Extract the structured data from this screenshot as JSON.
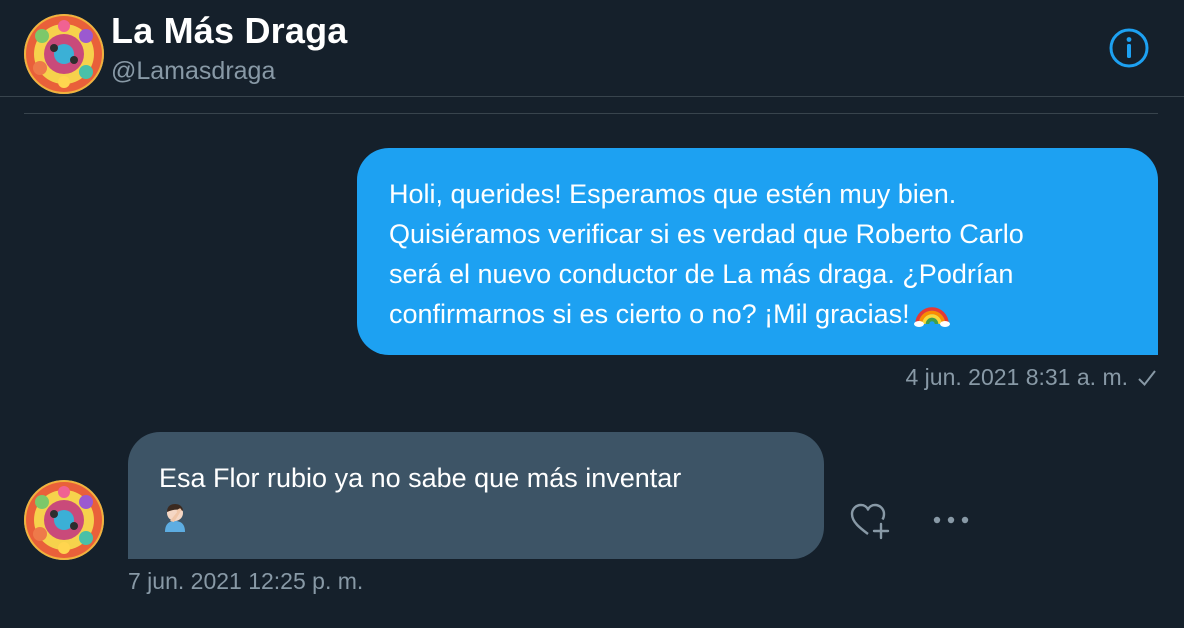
{
  "header": {
    "title": "La Más Draga",
    "handle": "@Lamasdraga",
    "info_icon": "info-circle-icon",
    "accent_color": "#1da1f2"
  },
  "conversation": {
    "messages": [
      {
        "direction": "sent",
        "lines": [
          "Holi, querides! Esperamos que estén muy bien.",
          "Quisiéramos verificar si es verdad que Roberto Carlo",
          "será el nuevo conductor de La más draga. ¿Podrían",
          "confirmarnos si es cierto o no? ¡Mil gracias!"
        ],
        "emoji": "rainbow",
        "timestamp": "4 jun. 2021 8:31 a. m.",
        "status_icon": "checkmark-icon",
        "bubble_color": "#1da1f2"
      },
      {
        "direction": "received",
        "lines": [
          "Esa Flor rubio ya no sabe que más inventar"
        ],
        "emoji": "person-facepalming",
        "timestamp": "7 jun. 2021 12:25 p. m.",
        "bubble_color": "#3d5466",
        "actions": [
          "add-reaction-icon",
          "more-options-icon"
        ]
      }
    ]
  },
  "theme": {
    "background": "#15202b",
    "secondary_text": "#8899a6",
    "border": "#38444d"
  }
}
